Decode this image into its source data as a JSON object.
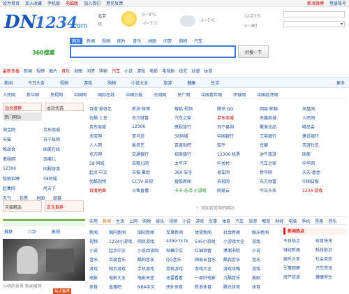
{
  "topbar": {
    "left": [
      "设为首页",
      "加入收藏",
      "手机版",
      "电脑版",
      "加入我们",
      "意见反馈"
    ],
    "right": [
      "新浪微博",
      "登录账号"
    ]
  },
  "logo": {
    "text": "DN1234.com"
  },
  "weather": {
    "city": "北京",
    "desc": "晴",
    "temp_today": "0~8°C",
    "temp_tomorrow": "-2~5°C",
    "date": "12月3日",
    "time": "4~9时"
  },
  "search": {
    "brand": "360搜索",
    "tabs": [
      "网页",
      "新闻",
      "视频",
      "图片",
      "音乐",
      "地图",
      "问答",
      "购物",
      "汽车"
    ],
    "button": "好搜一下",
    "hot": [
      "最新热搜",
      "新闻",
      "视频",
      "图片",
      "音乐",
      "地图",
      "问答",
      "购物",
      "汽车",
      "小说",
      "游戏",
      "电影",
      "电视剧",
      "综艺",
      "动漫",
      "体育"
    ]
  },
  "category_bar": {
    "items": [
      "新闻",
      "今日头条",
      "视频",
      "游戏",
      "购物",
      "小说大全",
      "旅游",
      "健康",
      "生活"
    ],
    "tail": "更多"
  },
  "nav_row2": [
    "人民网",
    "新华网",
    "央视网",
    "中国网",
    "国际在线",
    "中国日报",
    "光明网",
    "央广网",
    "中国青年网",
    "环球网",
    "中国经济网"
  ],
  "left_panel": {
    "top_labels": [
      "站长推荐",
      "本站优选",
      "热门网站"
    ],
    "grid": [
      [
        "淘宝网",
        "京东商城"
      ],
      [
        "天猫",
        "苏宁易购"
      ],
      [
        "唯品会",
        "国美在线"
      ],
      [
        "携程网",
        "去哪儿"
      ],
      [
        "12306",
        "同程旅游"
      ],
      [
        "智联招聘",
        "58同城"
      ],
      [
        "赶集网",
        "房天下"
      ]
    ],
    "small_links": [
      "天气",
      "彩票",
      "地图",
      "邮箱"
    ],
    "bottom_labels": [
      "天猫精选",
      "京东推荐"
    ]
  },
  "sites": {
    "rows": [
      [
        "百度·爱奇艺",
        "新浪·微博",
        "搜狐·视频",
        "腾讯·QQ",
        "网易·邮箱",
        "凤凰网"
      ],
      [
        "优酷·土豆",
        "东方财富",
        "汽车之家",
        "京东商城",
        "天猫商城",
        "人民网"
      ],
      [
        "京东商城",
        "12306",
        "携程旅行",
        "苏宁易购",
        "聚美优品",
        "唯品会"
      ],
      [
        "淘宝网",
        "亚马逊",
        "58同城",
        "中国银行",
        "工商银行",
        "建设银行"
      ],
      [
        "人人网",
        "爱奇艺",
        "百度贴吧",
        "知乎",
        "豆瓣",
        "天涯社区"
      ],
      [
        "东方网",
        "交通银行",
        "招商银行",
        "12306·机票",
        "途牛旅游",
        "国美"
      ],
      [
        "58·同城",
        "去哪儿网",
        "太平洋",
        "中关村",
        "汽车之家",
        "中华网"
      ],
      [
        "起点·中文",
        "天猫·聚划",
        "360·安全",
        "易车网",
        "新华网",
        "天天·基金"
      ],
      [
        "优酷视频",
        "CCTV·央视",
        "搜狐新闻",
        "央视网",
        "东方财富",
        "中国日报"
      ],
      [
        "百度地图",
        "斗鱼直播",
        "虎牙直播",
        "网易云",
        "今日头条",
        "1234·游戏"
      ]
    ],
    "special": "卡卡·乐活·小游戏",
    "add": "添加我常用的网站"
  },
  "bottom_tabs": [
    "实用",
    "新闻",
    "生活",
    "上网",
    "购物",
    "娱乐",
    "视频",
    "小说",
    "游戏",
    "军事",
    "体育",
    "汽车",
    "旅游",
    "教育",
    "财经",
    "电脑",
    "手机",
    "星座",
    "音乐"
  ],
  "bottom_left": {
    "tabs": [
      "推荐",
      "八卦",
      "影视"
    ],
    "photo_caption": "小明的世界 新闻推荐",
    "photo_tag": "热点推荐"
  },
  "bottom_rows": [
    [
      "新闻",
      "国内新闻",
      "国际新闻",
      "军事新闻",
      "体育新闻",
      "社会新闻",
      "娱乐新闻",
      "股票新闻",
      "科技新闻"
    ],
    [
      "视频",
      "1234小游戏",
      "网页游戏",
      "4399·7k7k",
      "545小游戏",
      "小游戏大全",
      "游戏"
    ],
    [
      "小说",
      "起点中文",
      "小说阅读网",
      "纵横中文",
      "红袖添香",
      "潇湘书院",
      "小说"
    ],
    [
      "音乐",
      "百度音乐",
      "酷狗音乐",
      "QQ音乐",
      "网易云音乐",
      "酷我音乐",
      "音乐"
    ],
    [
      "游戏",
      "网页游戏",
      "手机游戏",
      "单机游戏",
      "游戏大全",
      "游戏攻略",
      "游戏"
    ],
    [
      "电影",
      "电影大全",
      "电影天堂",
      "迅雷看看",
      "一部好电影",
      "九酷音乐",
      "美剧"
    ],
    [
      "体育",
      "直播吧",
      "NBA中文",
      "虎扑体育",
      "新浪体育",
      "腾讯体育",
      "体育"
    ]
  ],
  "bottom_right": {
    "title": "新闻热点",
    "items": [
      "今日热点",
      "体育快讯",
      "财经新闻",
      "科技前沿",
      "娱乐头条",
      "社会百态",
      "军事观察",
      "汽车资讯",
      "房产信息",
      "健康养生"
    ]
  }
}
